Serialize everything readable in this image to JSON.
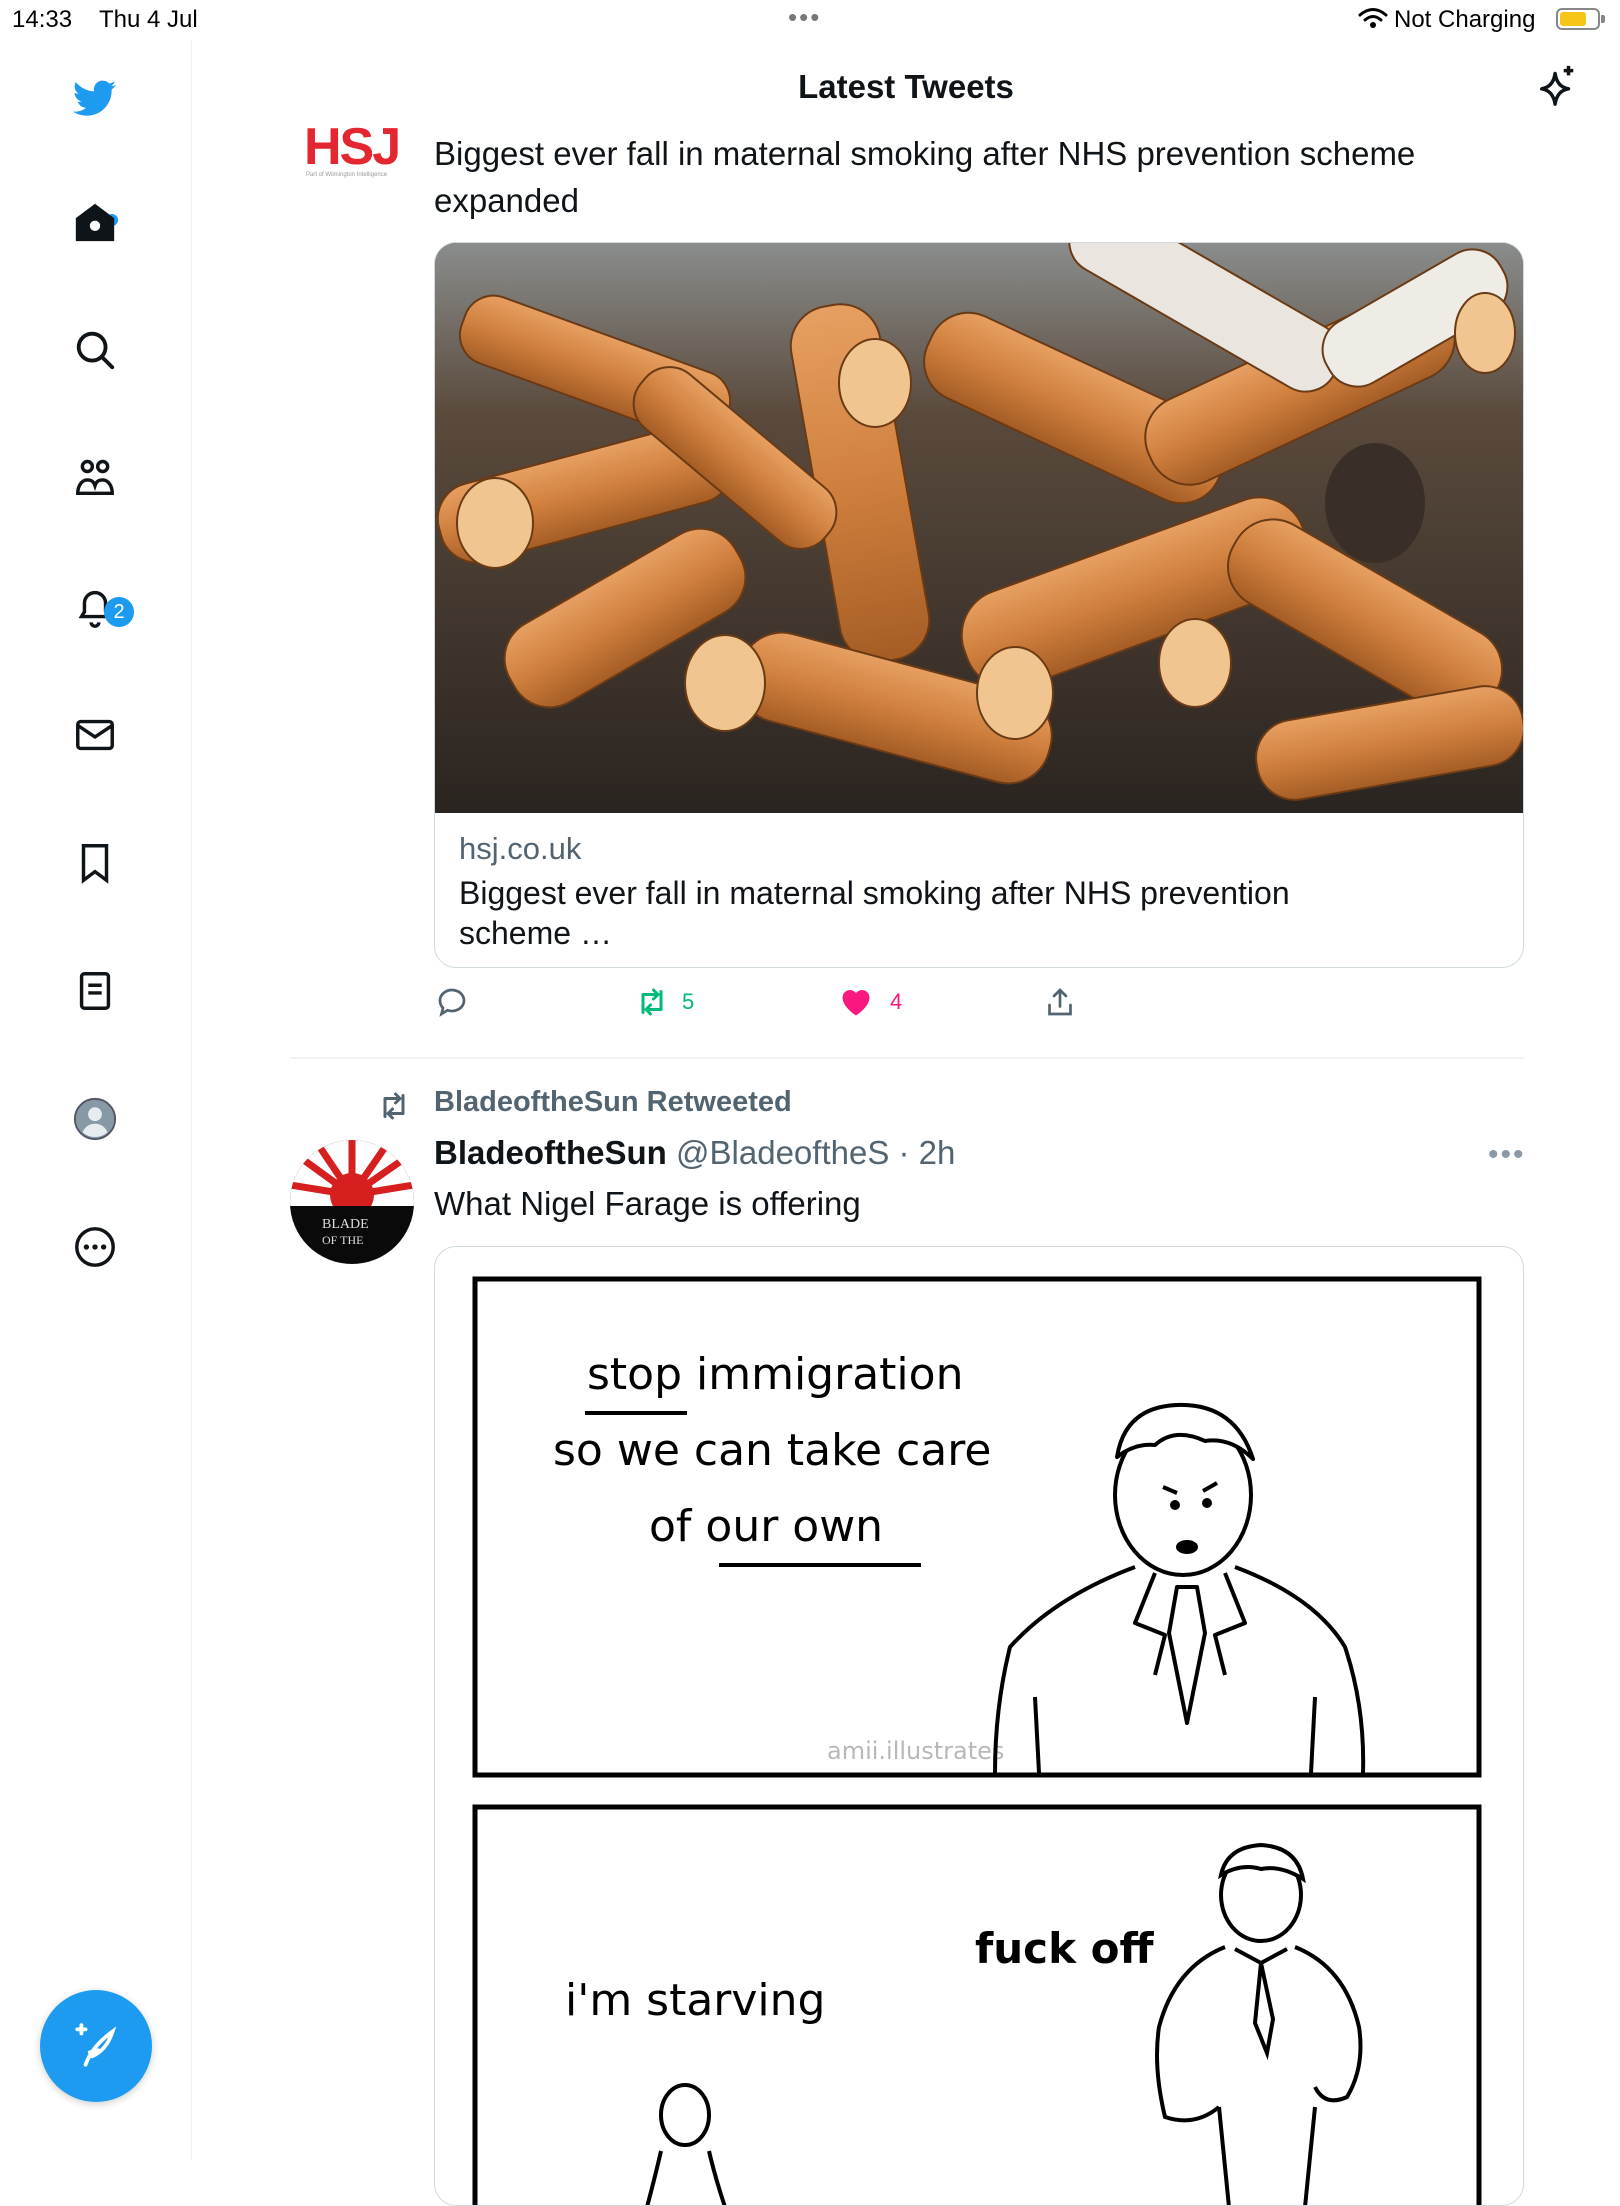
{
  "status_bar": {
    "time": "14:33",
    "date": "Thu 4 Jul",
    "charging": "Not Charging"
  },
  "sidebar": {
    "items": [
      "twitter-logo",
      "home",
      "search",
      "communities",
      "notifications",
      "messages",
      "bookmarks",
      "lists",
      "profile",
      "more"
    ],
    "notifications_badge": "2",
    "accent": "#1d9bf0"
  },
  "header": {
    "title": "Latest Tweets"
  },
  "tweet1": {
    "avatar_text": "HSJ",
    "avatar_subtext": "Part of Wilmington Intelligence",
    "text_line1": "Biggest ever fall in maternal smoking after NHS prevention scheme",
    "text_line2": "expanded",
    "card": {
      "domain": "hsj.co.uk",
      "title_line1": "Biggest ever fall in maternal smoking after NHS prevention",
      "title_line2": "scheme …"
    },
    "actions": {
      "retweets": "5",
      "likes": "4"
    }
  },
  "tweet2": {
    "retweeted_by": "BladeoftheSun Retweeted",
    "author_name": "BladeoftheSun",
    "author_handle": "@BladeoftheS",
    "time": "· 2h",
    "text": "What Nigel Farage is offering",
    "avatar_text_line1": "BLADE",
    "avatar_text_line2": "OF THE",
    "comic": {
      "panel1_line1": "stop immigration",
      "panel1_line2": "so we can take care",
      "panel1_line3": "of our own",
      "watermark": "amii.illustrates",
      "panel2_left": "i'm starving",
      "panel2_right": "fuck off"
    }
  }
}
